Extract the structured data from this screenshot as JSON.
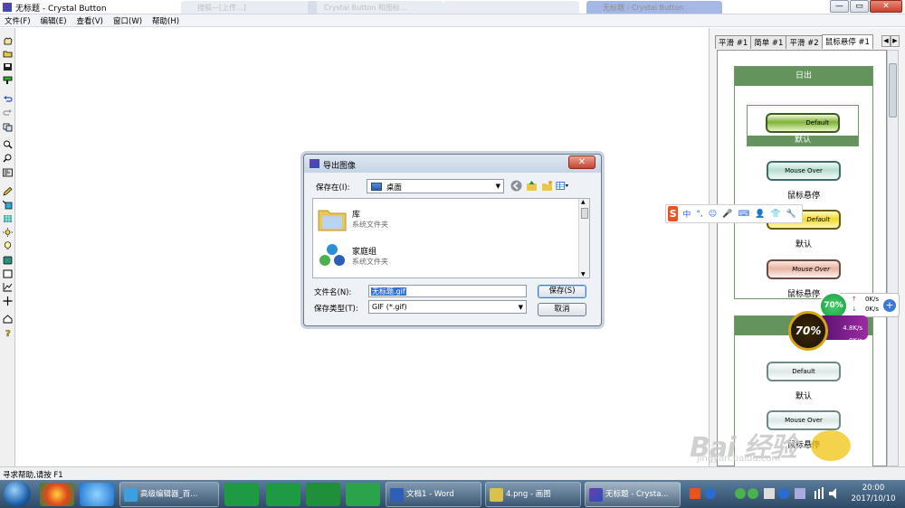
{
  "window": {
    "title": "无标题 - Crystal Button",
    "background_tabs": [
      "搜狐—[上传...]",
      "Crystal Button 和图标...",
      "",
      "无标题 - Crystal Button"
    ],
    "controls": {
      "minimize": "—",
      "maximize": "▭",
      "close": "✕"
    }
  },
  "menu": [
    "文件(F)",
    "编辑(E)",
    "查看(V)",
    "窗口(W)",
    "帮助(H)"
  ],
  "toolbar_icons": [
    "hand-icon",
    "open-folder-icon",
    "save-icon",
    "paint-icon",
    "undo-icon",
    "redo-icon",
    "copy-icon",
    "zoom-in-icon",
    "zoom-out-icon",
    "wand-icon",
    "pencil-icon",
    "fill-icon",
    "pattern-icon",
    "light-icon",
    "bulb-icon",
    "layer-icon",
    "rectangle-icon",
    "chart-icon",
    "move-icon",
    "home-icon",
    "help-icon"
  ],
  "right_panel": {
    "tabs": [
      "平滑 #1",
      "简单 #1",
      "平滑 #2",
      "鼠标悬停 #1"
    ],
    "active_tab": 3,
    "groups": [
      {
        "header": "日出",
        "cells": [
          {
            "button_text": "Default",
            "label": "默认",
            "style": "green",
            "selected": true
          },
          {
            "button_text": "Mouse Over",
            "label": "鼠标悬停",
            "style": "blue"
          },
          {
            "button_text": "Default",
            "label": "默认",
            "style": "yellow"
          },
          {
            "button_text": "Mouse Over",
            "label": "鼠标悬停",
            "style": "pink"
          }
        ]
      },
      {
        "header": "",
        "cells": [
          {
            "button_text": "Default",
            "label": "默认",
            "style": "white"
          },
          {
            "button_text": "Mouse Over",
            "label": "鼠标悬停",
            "style": "white"
          }
        ]
      }
    ]
  },
  "dialog": {
    "title": "导出图像",
    "save_in_label": "保存在(I):",
    "save_in_value": "桌面",
    "files": [
      {
        "name": "库",
        "type": "系统文件夹"
      },
      {
        "name": "家庭组",
        "type": "系统文件夹"
      }
    ],
    "filename_label": "文件名(N):",
    "filename_value": "无标题.gif",
    "filetype_label": "保存类型(T):",
    "filetype_value": "GIF (*.gif)",
    "save_button": "保存(S)",
    "cancel_button": "取消"
  },
  "ime": {
    "logo": "S",
    "items": [
      "中",
      "°,",
      "☺",
      "🎤",
      "⌨",
      "👤",
      "👕",
      "🔧"
    ]
  },
  "net_widget": {
    "percent": "70%",
    "up_rate": "0K/s",
    "down_rate": "0K/s"
  },
  "cat_widget": {
    "percent": "70%",
    "rate1": "4.8K/s",
    "rate2": "0K/s"
  },
  "status_text": "寻求帮助,请按 F1",
  "taskbar": {
    "buttons": [
      "高级编辑器_百...",
      "文档1 - Word",
      "4.png - 画图",
      "无标题 - Crysta..."
    ],
    "clock_time": "20:00",
    "clock_date": "2017/10/10"
  },
  "watermark": {
    "text": "Bai 经验",
    "url": "jingyan.baidu.com"
  }
}
